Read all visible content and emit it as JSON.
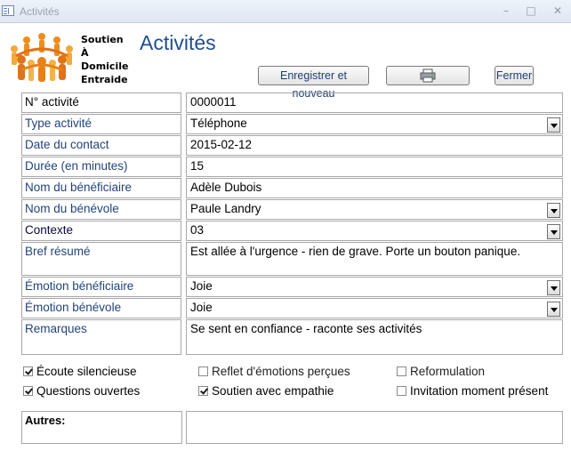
{
  "window": {
    "title": "Activités",
    "minimize": "–",
    "maximize": "□",
    "close": "✕"
  },
  "logo": {
    "line1": "Soutien",
    "line2": "À",
    "line3": "Domicile",
    "line4": "Entraide",
    "colors": [
      "#f5a623",
      "#e57b17",
      "#f2c14a"
    ]
  },
  "form": {
    "title": "Activités",
    "buttons": {
      "save_new": "Enregistrer et nouveau",
      "print_icon": "printer-icon",
      "close": "Fermer"
    },
    "fields": [
      {
        "label": "N° activité",
        "value": "0000011"
      },
      {
        "label": "Type activité",
        "value": "Téléphone"
      },
      {
        "label": "Date du contact",
        "value": "2015-02-12"
      },
      {
        "label": "Durée (en minutes)",
        "value": "15"
      },
      {
        "label": "Nom du bénéficiaire",
        "value": "Adèle Dubois"
      },
      {
        "label": "Nom du bénévole",
        "value": "Paule Landry"
      },
      {
        "label": "Contexte",
        "value": "03"
      },
      {
        "label": "Bref résumé",
        "value": "Est allée à l'urgence - rien de grave. Porte un bouton panique."
      },
      {
        "label": "Émotion bénéficiaire",
        "value": "Joie"
      },
      {
        "label": "Émotion bénévole",
        "value": "Joie"
      },
      {
        "label": "Remarques",
        "value": "Se sent en confiance - raconte ses activités"
      }
    ],
    "checkboxes": [
      {
        "label": "Écoute silencieuse",
        "checked": true
      },
      {
        "label": "Reflet d'émotions perçues",
        "checked": false
      },
      {
        "label": "Reformulation",
        "checked": false
      },
      {
        "label": "Questions ouvertes",
        "checked": true
      },
      {
        "label": "Soutien avec empathie",
        "checked": true
      },
      {
        "label": "Invitation moment présent",
        "checked": false
      }
    ],
    "autres_label": "Autres:",
    "autres_value": ""
  }
}
